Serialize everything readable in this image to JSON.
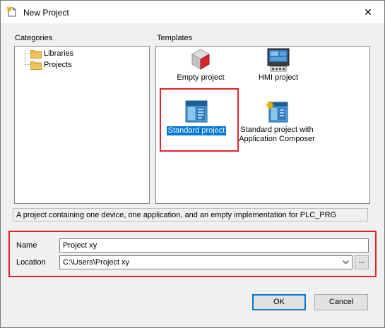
{
  "window": {
    "title": "New Project",
    "close_glyph": "✕"
  },
  "categories": {
    "label": "Categories",
    "items": [
      {
        "label": "Libraries",
        "icon": "folder-icon"
      },
      {
        "label": "Projects",
        "icon": "folder-icon"
      }
    ]
  },
  "templates": {
    "label": "Templates",
    "items": [
      {
        "label": "Empty project",
        "icon": "empty-project-icon",
        "selected": false
      },
      {
        "label": "HMI project",
        "icon": "hmi-project-icon",
        "selected": false
      },
      {
        "label": "Standard project",
        "icon": "standard-project-icon",
        "selected": true
      },
      {
        "label_line1": "Standard project with",
        "label_line2": "Application Composer",
        "icon": "application-composer-icon",
        "selected": false
      }
    ]
  },
  "description": "A project containing one device, one application, and an empty implementation for PLC_PRG",
  "form": {
    "name_label": "Name",
    "name_value": "Project xy",
    "location_label": "Location",
    "location_value": "C:\\Users\\Project xy",
    "browse_label": "..."
  },
  "buttons": {
    "ok": "OK",
    "cancel": "Cancel"
  },
  "colors": {
    "highlight_box": "#e3232c",
    "selection": "#0078d7"
  }
}
